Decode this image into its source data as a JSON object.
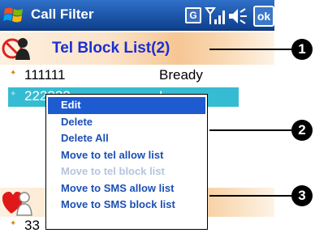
{
  "titlebar": {
    "title": "Call Filter",
    "g_label": "G",
    "ok_label": "ok",
    "icons": [
      "windows-start-icon",
      "signal-icon",
      "volume-icon"
    ]
  },
  "tel_block": {
    "title": "Tel Block List(2)"
  },
  "list": [
    {
      "number": "111111",
      "name": "Bready"
    },
    {
      "number": "222222",
      "name": "L"
    }
  ],
  "sms_list": [
    {
      "number": "33"
    }
  ],
  "context_menu": {
    "items": [
      {
        "label": "Edit",
        "state": "selected"
      },
      {
        "label": "Delete",
        "state": "enabled"
      },
      {
        "label": "Delete All",
        "state": "enabled"
      },
      {
        "label": "Move to tel allow list",
        "state": "enabled"
      },
      {
        "label": "Move to tel block list",
        "state": "disabled"
      },
      {
        "label": "Move to SMS allow list",
        "state": "enabled"
      },
      {
        "label": "Move to SMS block list",
        "state": "enabled"
      }
    ]
  },
  "callouts": [
    "1",
    "2",
    "3"
  ],
  "colors": {
    "titlebar": "#1e56b0",
    "header_text": "#1a2fd0",
    "selection": "#36bcd2",
    "menu_text": "#1b4fb5",
    "menu_disabled": "#b6c4df"
  }
}
